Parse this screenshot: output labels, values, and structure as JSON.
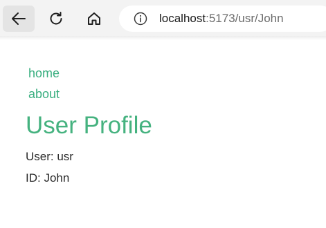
{
  "browser": {
    "url_host": "localhost",
    "url_rest": ":5173/usr/John",
    "icons": {
      "back": "arrow-left-icon",
      "reload": "reload-icon",
      "home": "home-icon",
      "info": "info-icon"
    }
  },
  "nav": {
    "home_label": "home",
    "about_label": "about"
  },
  "page": {
    "title": "User Profile",
    "user_line": "User: usr",
    "id_line": "ID: John"
  },
  "colors": {
    "accent": "#42b883",
    "link": "#3aaf80",
    "text": "#2a2a2a",
    "toolbar_bg": "#f3f3f3"
  }
}
